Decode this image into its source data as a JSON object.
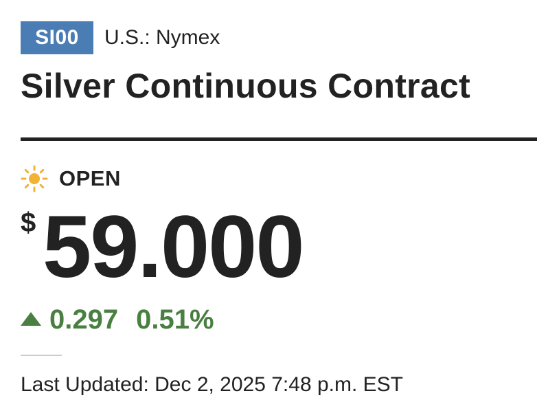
{
  "header": {
    "ticker": "SI00",
    "exchange": "U.S.: Nymex",
    "title": "Silver Continuous Contract"
  },
  "status": {
    "icon": "sun-icon",
    "label": "OPEN"
  },
  "quote": {
    "currency_symbol": "$",
    "price": "59.000",
    "direction_icon": "arrow-up-icon",
    "change": "0.297",
    "change_percent": "0.51%"
  },
  "footer": {
    "last_updated": "Last Updated: Dec 2, 2025 7:48 p.m. EST"
  },
  "colors": {
    "badge": "#4b7db5",
    "positive": "#4a7f42",
    "sun": "#f2b233",
    "text": "#222222"
  }
}
